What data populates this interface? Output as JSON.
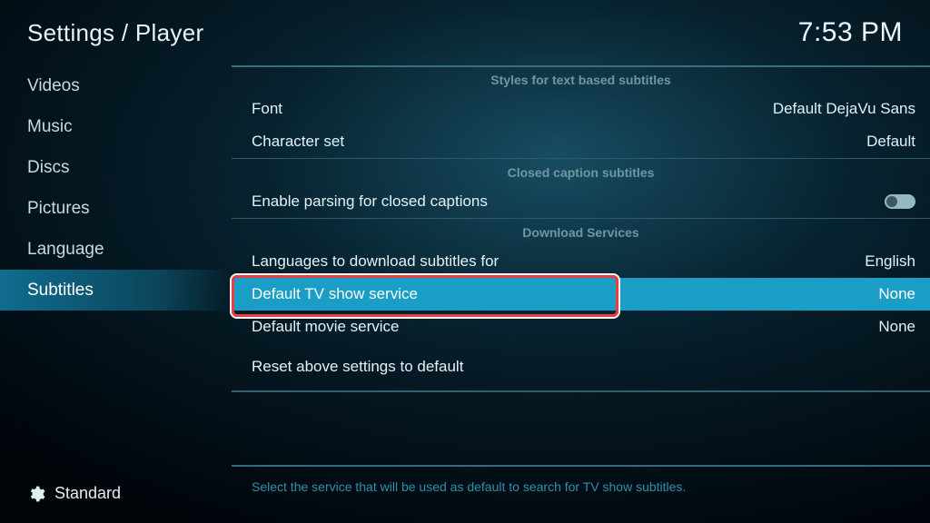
{
  "header": {
    "breadcrumb": "Settings / Player",
    "clock": "7:53 PM"
  },
  "sidebar": {
    "items": [
      {
        "label": "Videos"
      },
      {
        "label": "Music"
      },
      {
        "label": "Discs"
      },
      {
        "label": "Pictures"
      },
      {
        "label": "Language"
      },
      {
        "label": "Subtitles"
      }
    ],
    "active_index": 5,
    "level_label": "Standard"
  },
  "settings": {
    "groups": [
      {
        "title": "Styles for text based subtitles",
        "rows": [
          {
            "label": "Font",
            "value": "Default DejaVu Sans",
            "type": "text"
          },
          {
            "label": "Character set",
            "value": "Default",
            "type": "text"
          }
        ]
      },
      {
        "title": "Closed caption subtitles",
        "rows": [
          {
            "label": "Enable parsing for closed captions",
            "value": "",
            "type": "toggle",
            "toggled": false
          }
        ]
      },
      {
        "title": "Download Services",
        "rows": [
          {
            "label": "Languages to download subtitles for",
            "value": "English",
            "type": "text"
          },
          {
            "label": "Default TV show service",
            "value": "None",
            "type": "text",
            "selected": true,
            "highlighted": true
          },
          {
            "label": "Default movie service",
            "value": "None",
            "type": "text"
          },
          {
            "label": "Reset above settings to default",
            "value": "",
            "type": "action",
            "last": true
          }
        ]
      }
    ]
  },
  "footer": {
    "hint": "Select the service that will be used as default to search for TV show subtitles."
  }
}
